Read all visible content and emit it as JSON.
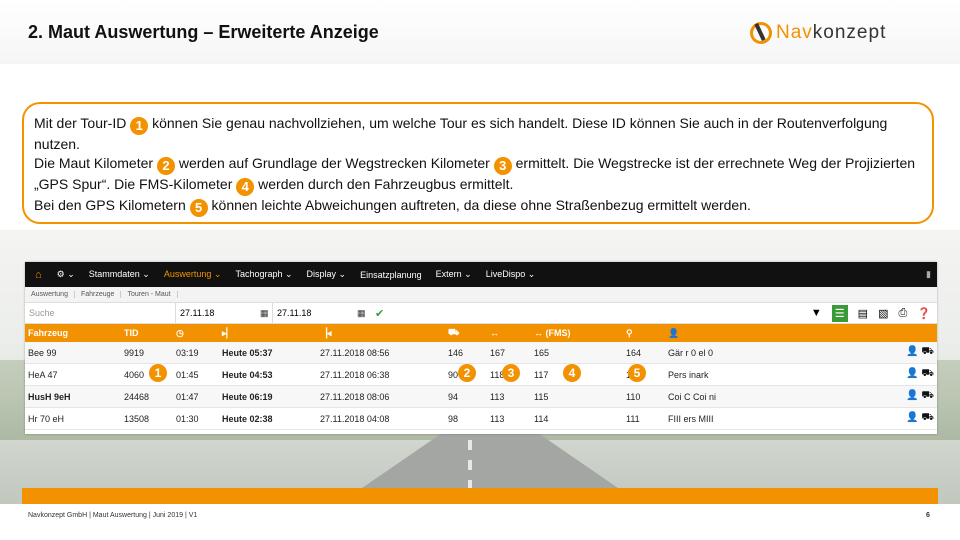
{
  "slide": {
    "title": "2. Maut Auswertung – Erweiterte Anzeige",
    "logo_a": "Nav",
    "logo_b": "konzept"
  },
  "text": {
    "p1a": "Mit der Tour-ID ",
    "p1b": " können Sie genau nachvollziehen, um welche Tour es sich handelt. Diese ID können Sie auch in der Routenverfolgung nutzen.",
    "p2a": "Die Maut Kilometer ",
    "p2b": " werden auf Grundlage der Wegstrecken Kilometer ",
    "p2c": " ermittelt. Die Wegstrecke ist der errechnete Weg der Projizierten „GPS Spur“. Die FMS-Kilometer ",
    "p2d": " werden durch den Fahrzeugbus ermittelt.",
    "p3a": "Bei den GPS Kilometern ",
    "p3b": " können leichte Abweichungen auftreten, da diese ohne Straßenbezug ermittelt werden.",
    "n1": "1",
    "n2": "2",
    "n3": "3",
    "n4": "4",
    "n5": "5"
  },
  "nav": {
    "home_icon": "⌂",
    "gear_icon": "⚙ ⌄",
    "items": [
      "Stammdaten ⌄",
      "Auswertung ⌄",
      "Tachograph ⌄",
      "Display ⌄",
      "Einsatzplanung",
      "Extern ⌄",
      "LiveDispo ⌄"
    ],
    "right_icon": "▮"
  },
  "breadcrumbs": [
    "Auswertung",
    "Fahrzeuge",
    "Touren - Maut"
  ],
  "filters": {
    "search_placeholder": "Suche",
    "date_from": "27.11.18",
    "date_to": "27.11.18",
    "calendar_icon": "▦",
    "check_icon": "✔"
  },
  "tools": [
    "▼",
    "☰",
    "▤",
    "▧",
    "⎙",
    "❓"
  ],
  "table": {
    "headers": [
      "Fahrzeug",
      "TID",
      "◷",
      "▸▏",
      "▕◂",
      "⛟",
      "↔",
      "↔ (FMS)",
      "⚲",
      "👤",
      ""
    ],
    "rows": [
      [
        "Bee 99",
        "9919",
        "03:19",
        "Heute 05:37",
        "27.11.2018 08:56",
        "146",
        "167",
        "165",
        "164",
        "Gär r 0 el 0"
      ],
      [
        "HeA 47",
        "4060",
        "01:45",
        "Heute 04:53",
        "27.11.2018 06:38",
        "90",
        "118",
        "117",
        "114",
        "Pers inark"
      ],
      [
        "HusH 9eH",
        "24468",
        "01:47",
        "Heute 06:19",
        "27.11.2018 08:06",
        "94",
        "113",
        "115",
        "110",
        "Coi C Coi ni"
      ],
      [
        "Hr 70 eH",
        "13508",
        "01:30",
        "Heute 02:38",
        "27.11.2018 04:08",
        "98",
        "113",
        "114",
        "111",
        "FIII ers MIII"
      ]
    ],
    "row_icons": "👤 ⛟"
  },
  "markers": [
    "1",
    "2",
    "3",
    "4",
    "5"
  ],
  "footer": {
    "text": "Navkonzept GmbH | Maut Auswertung | Juni 2019 | V1",
    "page": "6"
  }
}
